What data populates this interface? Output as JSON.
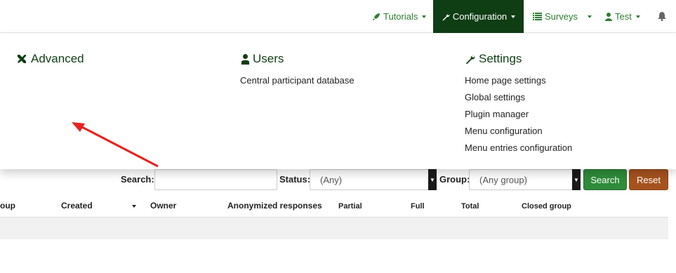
{
  "navbar": {
    "tutorials_label": "Tutorials",
    "configuration_label": "Configuration",
    "surveys_label": "Surveys",
    "user_label": "Test",
    "accent_color": "#2e7d32",
    "active_bg_color": "#0f3d14"
  },
  "menu": {
    "advanced": {
      "heading": "Advanced",
      "icon": "tools-icon"
    },
    "users": {
      "heading": "Users",
      "icon": "user-icon",
      "links": [
        "Central participant database"
      ]
    },
    "settings": {
      "heading": "Settings",
      "icon": "wrench-icon",
      "links": [
        "Home page settings",
        "Global settings",
        "Plugin manager",
        "Menu configuration",
        "Menu entries configuration"
      ]
    }
  },
  "filters": {
    "search_label": "Search:",
    "status_label": "Status:",
    "status_value": "(Any)",
    "group_label": "Group:",
    "group_value": "(Any group)",
    "search_button": "Search",
    "reset_button": "Reset"
  },
  "table": {
    "columns": [
      "oup",
      "Created",
      "Owner",
      "Anonymized responses",
      "Partial",
      "Full",
      "Total",
      "Closed group"
    ]
  }
}
